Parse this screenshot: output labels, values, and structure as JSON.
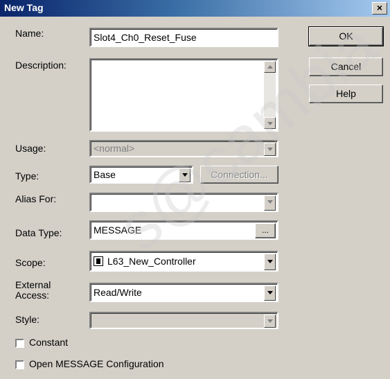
{
  "window": {
    "title": "New Tag",
    "close_glyph": "×"
  },
  "form": {
    "name_label": "Name:",
    "name_value": "Slot4_Ch0_Reset_Fuse",
    "description_label": "Description:",
    "description_value": "",
    "usage_label": "Usage:",
    "usage_value": "<normal>",
    "type_label": "Type:",
    "type_value": "Base",
    "connection_label": "Connection...",
    "alias_label": "Alias For:",
    "alias_value": "",
    "datatype_label": "Data Type:",
    "datatype_value": "MESSAGE",
    "datatype_browse": "...",
    "scope_label": "Scope:",
    "scope_value": "L63_New_Controller",
    "scope_icon": "controller-icon",
    "access_label_1": "External",
    "access_label_2": "Access:",
    "access_value": "Read/Write",
    "style_label": "Style:",
    "style_value": "",
    "constant_label": "Constant",
    "constant_checked": false,
    "open_config_label": "Open MESSAGE Configuration",
    "open_config_checked": false
  },
  "buttons": {
    "ok": "OK",
    "cancel": "Cancel",
    "help": "Help"
  },
  "watermark": "s@cambia"
}
